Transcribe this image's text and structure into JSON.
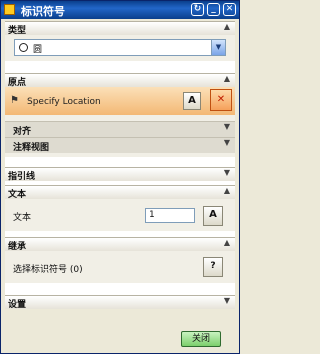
{
  "window": {
    "title": "标识符号",
    "buttons": [
      "↻",
      "_",
      "✕"
    ]
  },
  "sections": {
    "type": {
      "title": "类型",
      "selected_value": "圆"
    },
    "origin": {
      "title": "原点",
      "specify_location": "Specify Location",
      "align": "对齐",
      "annotation_view": "注释视图"
    },
    "leader": {
      "title": "指引线"
    },
    "text": {
      "title": "文本",
      "field_label": "文本",
      "field_value": "1"
    },
    "inherit": {
      "title": "继承",
      "select_label": "选择标识符号 (0)"
    },
    "settings": {
      "title": "设置"
    }
  },
  "footer": {
    "close_label": "关闭"
  },
  "icons": {
    "collapse": "chevron-up-icon",
    "expand": "chevron-down-icon",
    "text_style": "text-style-icon",
    "select_location": "select-location-icon"
  },
  "colors": {
    "title_bar": "#1f5db8",
    "highlight_row": "#f3b874",
    "close_button": "#7ccf6c"
  }
}
